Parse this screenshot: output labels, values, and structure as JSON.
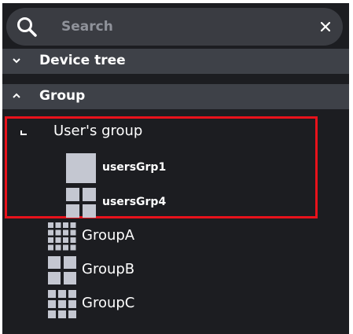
{
  "search": {
    "placeholder": "Search",
    "value": ""
  },
  "sections": {
    "device_tree": {
      "label": "Device tree",
      "state": "collapsed"
    },
    "group": {
      "label": "Group",
      "state": "expanded"
    }
  },
  "tree": {
    "users_group": {
      "label": "User's group",
      "state": "expanded",
      "children": [
        {
          "label": "usersGrp1",
          "icon": "single-tile-icon"
        },
        {
          "label": "usersGrp4",
          "icon": "grid-2x2-icon"
        }
      ]
    },
    "groups": [
      {
        "label": "GroupA",
        "icon": "grid-4x4-icon"
      },
      {
        "label": "GroupB",
        "icon": "grid-2x2-icon"
      },
      {
        "label": "GroupC",
        "icon": "grid-3x3-icon"
      }
    ]
  },
  "colors": {
    "panel_background": "#1c1d21",
    "header_background": "#3e4148",
    "search_background": "#3a3c42",
    "tile": "#c4c7d1",
    "highlight": "#e8121b"
  }
}
